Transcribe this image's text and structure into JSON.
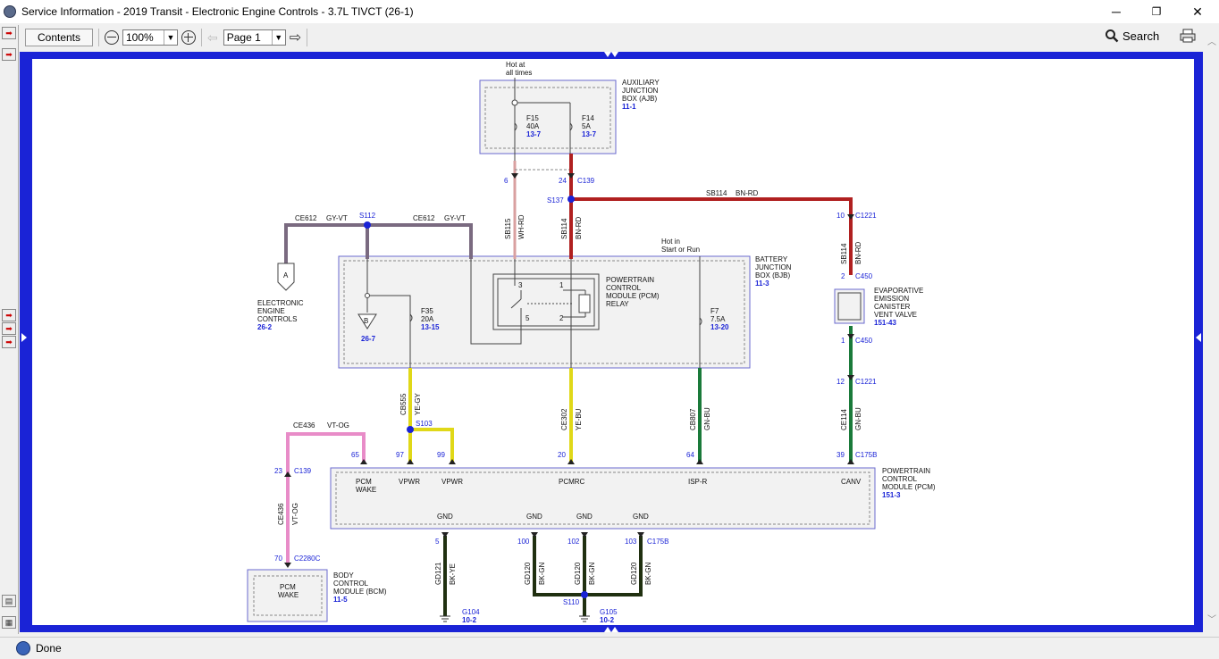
{
  "window": {
    "title": "Service Information - 2019 Transit - Electronic Engine Controls - 3.7L TIVCT (26-1)",
    "minimize": "─",
    "maximize": "❐",
    "close": "✕"
  },
  "toolbar": {
    "contents_label": "Contents",
    "zoom_value": "100%",
    "page_value": "Page 1",
    "search_label": "Search",
    "print_icon": "printer-icon"
  },
  "status": {
    "text": "Done"
  },
  "diagram": {
    "ajb": {
      "title1": "AUXILIARY",
      "title2": "JUNCTION",
      "title3": "BOX (AJB)",
      "ref": "11-1",
      "hot1": "Hot at",
      "hot2": "all times",
      "f15_name": "F15",
      "f15_amp": "40A",
      "f15_ref": "13-7",
      "f14_name": "F14",
      "f14_amp": "5A",
      "f14_ref": "13-7"
    },
    "bjb": {
      "title1": "BATTERY",
      "title2": "JUNCTION",
      "title3": "BOX (BJB)",
      "ref": "11-3",
      "hot1": "Hot in",
      "hot2": "Start or Run",
      "f35_name": "F35",
      "f35_amp": "20A",
      "f35_ref": "13-15",
      "f7_name": "F7",
      "f7_amp": "7.5A",
      "f7_ref": "13-20",
      "relay1": "POWERTRAIN",
      "relay2": "CONTROL",
      "relay3": "MODULE (PCM)",
      "relay4": "RELAY",
      "pin3": "3",
      "pin1": "1",
      "pin5": "5",
      "pin2": "2",
      "b_label": "B",
      "b_ref": "26-7"
    },
    "eec": {
      "label1": "ELECTRONIC",
      "label2": "ENGINE",
      "label3": "CONTROLS",
      "ref": "26-2",
      "a_label": "A"
    },
    "evap": {
      "label1": "EVAPORATIVE",
      "label2": "EMISSION",
      "label3": "CANISTER",
      "label4": "VENT VALVE",
      "ref": "151-43"
    },
    "pcm": {
      "label1": "POWERTRAIN",
      "label2": "CONTROL",
      "label3": "MODULE (PCM)",
      "ref": "151-3",
      "pin_pcmwake1": "PCM",
      "pin_pcmwake2": "WAKE",
      "pin_vpwr1": "VPWR",
      "pin_vpwr2": "VPWR",
      "pin_pcmrc": "PCMRC",
      "pin_ispr": "ISP-R",
      "pin_canv": "CANV",
      "gnd1": "GND",
      "gnd2": "GND",
      "gnd3": "GND",
      "gnd4": "GND"
    },
    "bcm": {
      "label1": "BODY",
      "label2": "CONTROL",
      "label3": "MODULE (BCM)",
      "ref": "11-5",
      "inner1": "PCM",
      "inner2": "WAKE"
    },
    "wires": {
      "ce612_a": "CE612",
      "gyvt_a": "GY-VT",
      "ce612_b": "CE612",
      "gyvt_b": "GY-VT",
      "s112": "S112",
      "s137": "S137",
      "s103": "S103",
      "s110": "S110",
      "sb114_h": "SB114",
      "bnrd_h": "BN-RD",
      "sb115": "SB115",
      "whrd": "WH-RD",
      "sb114_v": "SB114",
      "bnrd_v": "BN-RD",
      "sb114_r": "SB114",
      "bnrd_r": "BN-RD",
      "cb555": "CB555",
      "yegy": "YE-GY",
      "ce302": "CE302",
      "yebu": "YE-BU",
      "cb807": "CB807",
      "gnbu": "GN-BU",
      "ce114": "CE114",
      "gnbu2": "GN-BU",
      "ce436_h": "CE436",
      "vtog_h": "VT-OG",
      "ce436_v": "CE436",
      "vtog_v": "VT-OG",
      "gd121": "GD121",
      "bkye": "BK-YE",
      "gd120a": "GD120",
      "bkgn_a": "BK-GN",
      "gd120b": "GD120",
      "bkgn_b": "BK-GN",
      "gd120c": "GD120",
      "bkgn_c": "BK-GN"
    },
    "connectors": {
      "c139_24": "24",
      "c139_lbl": "C139",
      "n6": "6",
      "c1221_10": "10",
      "c1221_lbl": "C1221",
      "c450_2": "2",
      "c450_lbl": "C450",
      "c450_1": "1",
      "c450_lbl2": "C450",
      "c1221_12": "12",
      "c1221_lbl2": "C1221",
      "p65": "65",
      "p97": "97",
      "p99": "99",
      "p20": "20",
      "p64": "64",
      "p39": "39",
      "c175b": "C175B",
      "p23": "23",
      "c139_2": "C139",
      "p70": "70",
      "c2280c": "C2280C",
      "p5": "5",
      "p100": "100",
      "p102": "102",
      "p103": "103",
      "c175b_2": "C175B",
      "g104": "G104",
      "g104_ref": "10-2",
      "g105": "G105",
      "g105_ref": "10-2"
    }
  }
}
